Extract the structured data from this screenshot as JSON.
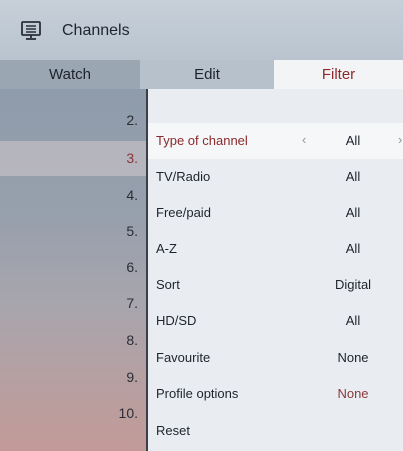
{
  "header": {
    "title": "Channels",
    "icon": "tv-icon"
  },
  "tabs": [
    {
      "label": "Watch"
    },
    {
      "label": "Edit"
    },
    {
      "label": "Filter"
    }
  ],
  "channel_numbers": [
    "2.",
    "3.",
    "4.",
    "5.",
    "6.",
    "7.",
    "8.",
    "9.",
    "10."
  ],
  "filter": {
    "rows": [
      {
        "label": "Type of channel",
        "value": "All",
        "left_arrow": "‹",
        "right_arrow": "›"
      },
      {
        "label": "TV/Radio",
        "value": "All"
      },
      {
        "label": "Free/paid",
        "value": "All"
      },
      {
        "label": "A-Z",
        "value": "All"
      },
      {
        "label": "Sort",
        "value": "Digital"
      },
      {
        "label": "HD/SD",
        "value": "All"
      },
      {
        "label": "Favourite",
        "value": "None"
      },
      {
        "label": "Profile options",
        "value": "None"
      },
      {
        "label": "Reset",
        "value": ""
      }
    ]
  },
  "colors": {
    "accent": "#8a2a2a",
    "selected_row_bg": "#f6f7f9",
    "panel_bg": "#e9edf2"
  }
}
